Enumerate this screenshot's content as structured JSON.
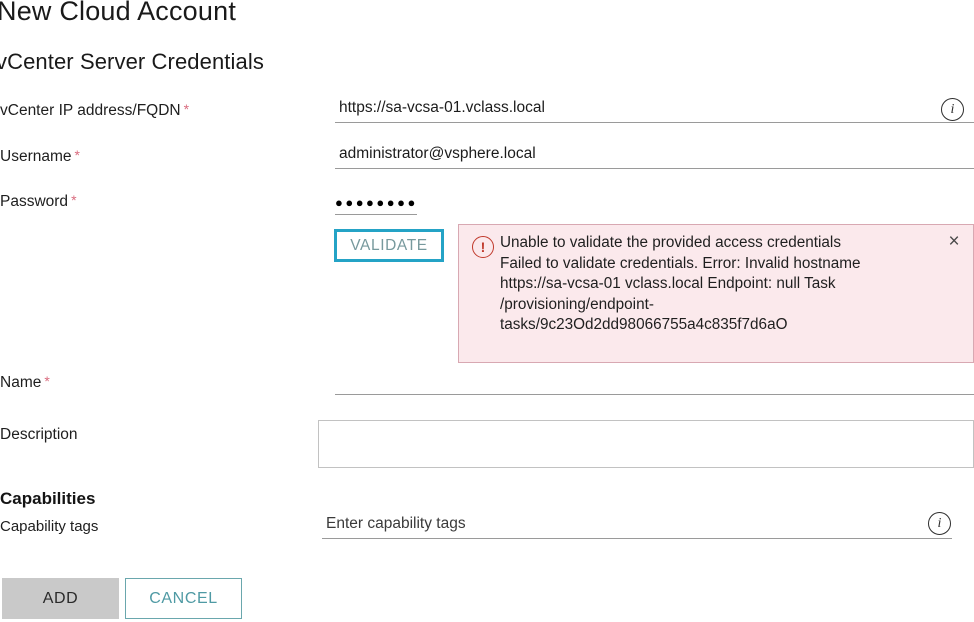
{
  "page": {
    "title": "New Cloud Account",
    "section_title": "vCenter Server Credentials",
    "capabilities_title": "Capabilities"
  },
  "colors": {
    "accent_teal": "#24a3c6",
    "cancel_teal": "#4f9aa4",
    "error_bg": "#fbe9ec",
    "error_border": "#d8a8b2",
    "error_icon": "#c0392b",
    "required_asterisk": "#d96b7e",
    "add_button_bg": "#c9c9c9"
  },
  "form": {
    "fqdn": {
      "label": "vCenter IP address/FQDN",
      "required_marker": "*",
      "value": "https://sa-vcsa-01.vclass.local",
      "placeholder": "",
      "info_icon": "info-icon"
    },
    "username": {
      "label": "Username",
      "required_marker": "*",
      "value": "administrator@vsphere.local",
      "placeholder": ""
    },
    "password": {
      "label": "Password",
      "required_marker": "*",
      "value": "●●●●●●●●",
      "masked_char_count": 8
    },
    "name": {
      "label": "Name",
      "required_marker": "*",
      "value": "",
      "placeholder": ""
    },
    "description": {
      "label": "Description",
      "value": "",
      "placeholder": ""
    }
  },
  "validate": {
    "label": "VALIDATE"
  },
  "error": {
    "icon": "exclamation-circle-icon",
    "close_icon": "close-icon",
    "close_label": "×",
    "message": "Unable to validate the provided access credentials\nFailed to validate credentials. Error: Invalid hostname\nhttps://sa-vcsa-01 vclass.local Endpoint: null Task\n/provisioning/endpoint-\ntasks/9c23Od2dd98066755a4c835f7d6aO"
  },
  "capabilities": {
    "tags": {
      "label": "Capability tags",
      "value": "",
      "placeholder": "Enter capability tags",
      "info_icon": "info-icon"
    }
  },
  "footer": {
    "add_label": "ADD",
    "cancel_label": "CANCEL"
  }
}
